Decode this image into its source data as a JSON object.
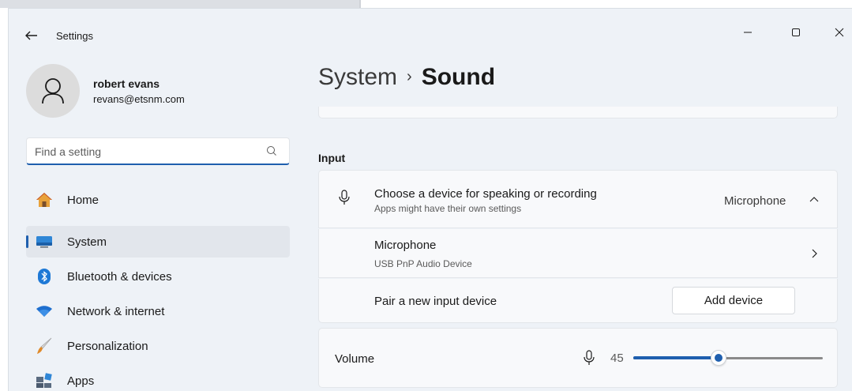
{
  "window": {
    "title": "Settings"
  },
  "profile": {
    "name": "robert evans",
    "email": "revans@etsnm.com"
  },
  "search": {
    "placeholder": "Find a setting"
  },
  "nav": {
    "items": [
      {
        "label": "Home",
        "icon": "home-icon"
      },
      {
        "label": "System",
        "icon": "system-icon",
        "active": true
      },
      {
        "label": "Bluetooth & devices",
        "icon": "bluetooth-icon"
      },
      {
        "label": "Network & internet",
        "icon": "wifi-icon"
      },
      {
        "label": "Personalization",
        "icon": "brush-icon"
      },
      {
        "label": "Apps",
        "icon": "apps-icon"
      }
    ]
  },
  "breadcrumb": {
    "parent": "System",
    "separator": "›",
    "current": "Sound"
  },
  "input": {
    "section_label": "Input",
    "choose_device": {
      "title": "Choose a device for speaking or recording",
      "subtitle": "Apps might have their own settings",
      "value": "Microphone"
    },
    "device": {
      "title": "Microphone",
      "subtitle": "USB PnP Audio Device"
    },
    "pair": {
      "title": "Pair a new input device",
      "button_label": "Add device"
    },
    "volume": {
      "label": "Volume",
      "value": "45",
      "level_percent": 45
    }
  },
  "colors": {
    "accent": "#1f5fae",
    "window_bg": "#eef2f7",
    "card_bg": "#f8f9fb"
  }
}
